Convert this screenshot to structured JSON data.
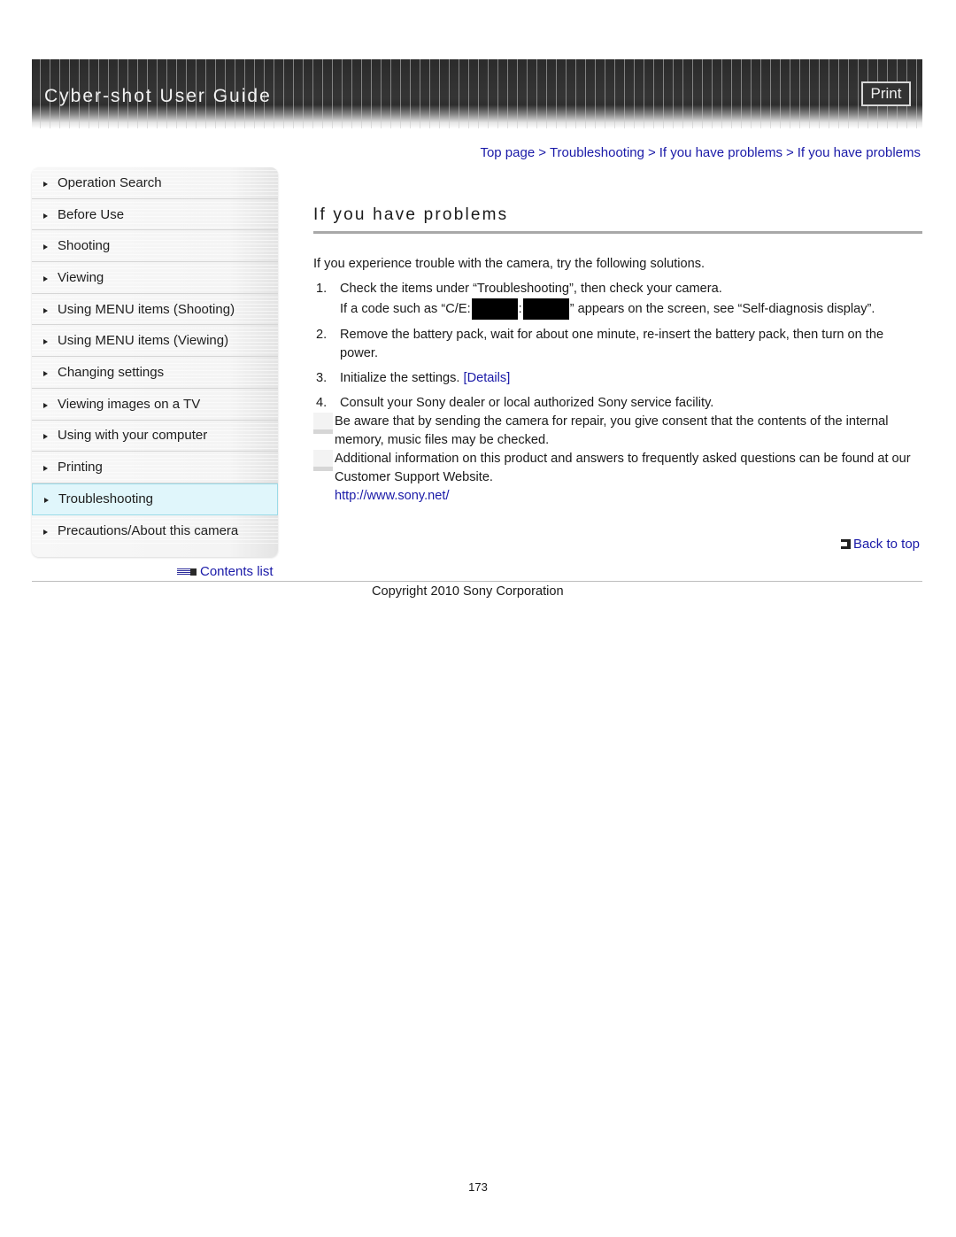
{
  "header": {
    "title": "Cyber-shot User Guide",
    "print_label": "Print"
  },
  "sidebar": {
    "items": [
      {
        "label": "Operation Search",
        "active": false
      },
      {
        "label": "Before Use",
        "active": false
      },
      {
        "label": "Shooting",
        "active": false
      },
      {
        "label": "Viewing",
        "active": false
      },
      {
        "label": "Using MENU items (Shooting)",
        "active": false
      },
      {
        "label": "Using MENU items (Viewing)",
        "active": false
      },
      {
        "label": "Changing settings",
        "active": false
      },
      {
        "label": "Viewing images on a TV",
        "active": false
      },
      {
        "label": "Using with your computer",
        "active": false
      },
      {
        "label": "Printing",
        "active": false
      },
      {
        "label": "Troubleshooting",
        "active": true
      },
      {
        "label": "Precautions/About this camera",
        "active": false
      }
    ],
    "contents_list_label": "Contents list"
  },
  "breadcrumb": {
    "items": [
      "Top page",
      "Troubleshooting",
      "If you have problems",
      "If you have problems"
    ],
    "separator": ">"
  },
  "main": {
    "title": "If you have problems",
    "intro": "If you experience trouble with the camera, try the following solutions.",
    "steps": [
      {
        "num": "1.",
        "text": "Check the items under “Troubleshooting”, then check your camera.",
        "sub_prefix": "If a code such as “C/E:",
        "sub_colon": ":",
        "sub_suffix": "” appears on the screen, see “Self-diagnosis display”."
      },
      {
        "num": "2.",
        "text": "Remove the battery pack, wait for about one minute, re-insert the battery pack, then turn on the power."
      },
      {
        "num": "3.",
        "text": "Initialize the settings.",
        "link": "[Details]"
      },
      {
        "num": "4.",
        "text": "Consult your Sony dealer or local authorized Sony service facility."
      }
    ],
    "notes": [
      "Be aware that by sending the camera for repair, you give consent that the contents of the internal memory, music files may be checked.",
      "Additional information on this product and answers to frequently asked questions can be found at our Customer Support Website."
    ],
    "support_url": "http://www.sony.net/",
    "back_to_top_label": "Back to top"
  },
  "footer": {
    "copyright": "Copyright 2010 Sony Corporation",
    "page_number": "173"
  },
  "colors": {
    "link": "#1a1aa8",
    "header_bg": "#333333",
    "active_nav_bg": "#e0f6fb",
    "active_nav_border": "#9adbe8"
  }
}
